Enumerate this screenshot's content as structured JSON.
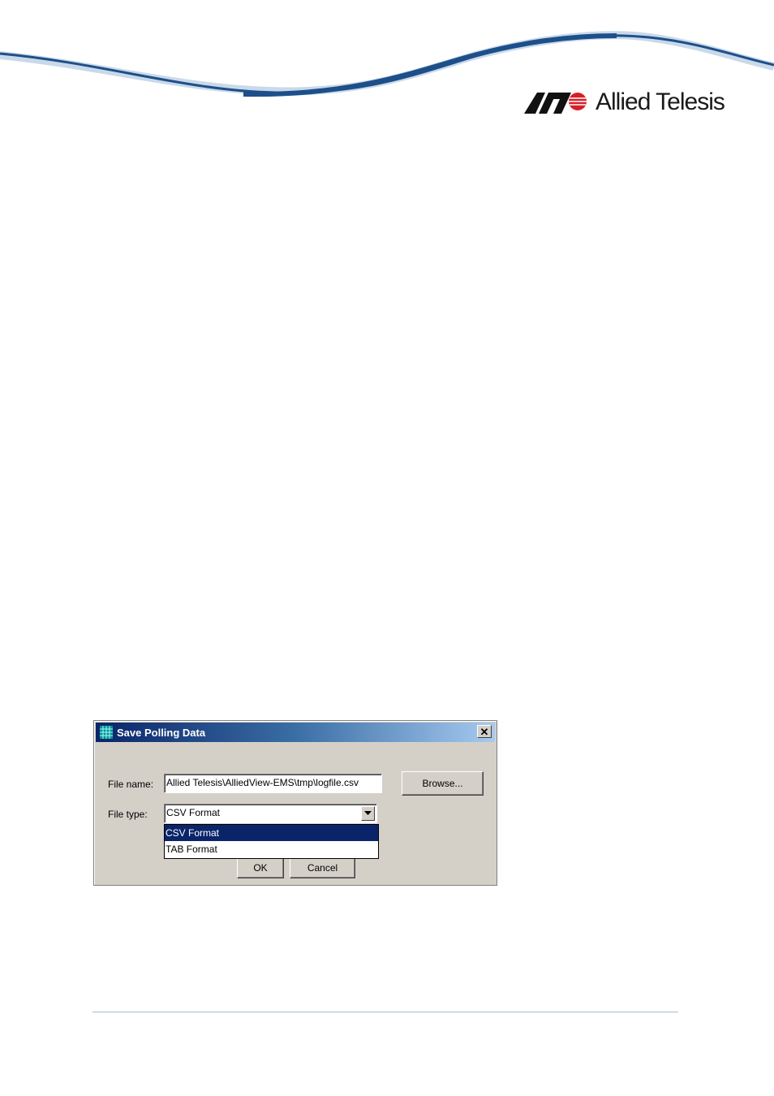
{
  "brand": {
    "name": "Allied Telesis"
  },
  "dialog": {
    "title": "Save Polling Data",
    "close_label": "✕",
    "file_name_label": "File name:",
    "file_name_value": "Allied Telesis\\AlliedView-EMS\\tmp\\logfile.csv",
    "browse_label": "Browse...",
    "file_type_label": "File type:",
    "file_type_selected": "CSV Format",
    "file_type_options": [
      "CSV Format",
      "TAB Format"
    ],
    "ok_label": "OK",
    "cancel_label": "Cancel"
  },
  "colors": {
    "title_start": "#0a246a",
    "title_end": "#a6caf0",
    "selection": "#0a246a",
    "dialog_face": "#d4d0c8",
    "swoosh_dark": "#1d4f8a",
    "logo_red": "#d81e28"
  }
}
